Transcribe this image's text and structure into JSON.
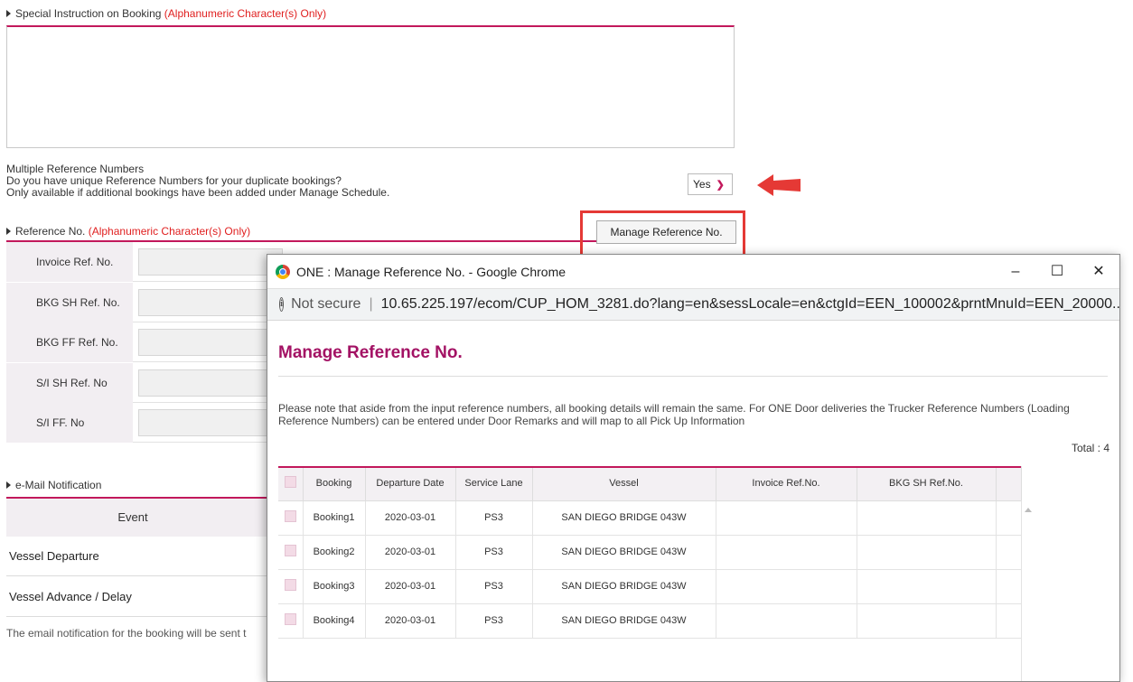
{
  "special_instruction": {
    "label": "Special Instruction on Booking",
    "note": "(Alphanumeric Character(s) Only)",
    "value": ""
  },
  "multiple_ref": {
    "title": "Multiple Reference Numbers",
    "question": "Do you have unique Reference Numbers for your duplicate bookings?",
    "hint": "Only available if additional bookings have been added under Manage Schedule.",
    "selected": "Yes"
  },
  "reference": {
    "label": "Reference No.",
    "note": "(Alphanumeric Character(s) Only)",
    "manage_button": "Manage Reference No.",
    "fields": [
      {
        "label": "Invoice Ref. No.",
        "value": ""
      },
      {
        "label": "BKG SH Ref. No.",
        "value": ""
      },
      {
        "label": "BKG FF Ref. No.",
        "value": ""
      },
      {
        "label": "S/I SH Ref. No",
        "value": ""
      },
      {
        "label": "S/I FF. No",
        "value": ""
      }
    ]
  },
  "email": {
    "label": "e-Mail Notification",
    "event_header": "Event",
    "events": [
      "Vessel Departure",
      "Vessel Advance / Delay"
    ],
    "footnote": "The email notification for the booking will be sent t"
  },
  "popup": {
    "window_title": "ONE : Manage Reference No. - Google Chrome",
    "controls": {
      "minimize": "–",
      "maximize": "☐",
      "close": "✕"
    },
    "not_secure": "Not secure",
    "url": "10.65.225.197/ecom/CUP_HOM_3281.do?lang=en&sessLocale=en&ctgId=EEN_100002&prntMnuId=EEN_20000...",
    "title": "Manage Reference No.",
    "note": "Please note that aside from the input reference numbers, all booking details will remain the same. For ONE Door deliveries the Trucker Reference Numbers (Loading Reference Numbers) can be entered under Door Remarks and will map to all Pick Up Information",
    "total": "Total : 4",
    "columns": [
      "Booking",
      "Departure Date",
      "Service Lane",
      "Vessel",
      "Invoice Ref.No.",
      "BKG SH Ref.No."
    ],
    "rows": [
      {
        "booking": "Booking1",
        "date": "2020-03-01",
        "lane": "PS3",
        "vessel": "SAN DIEGO BRIDGE 043W",
        "inv": "",
        "bkg": ""
      },
      {
        "booking": "Booking2",
        "date": "2020-03-01",
        "lane": "PS3",
        "vessel": "SAN DIEGO BRIDGE 043W",
        "inv": "",
        "bkg": ""
      },
      {
        "booking": "Booking3",
        "date": "2020-03-01",
        "lane": "PS3",
        "vessel": "SAN DIEGO BRIDGE 043W",
        "inv": "",
        "bkg": ""
      },
      {
        "booking": "Booking4",
        "date": "2020-03-01",
        "lane": "PS3",
        "vessel": "SAN DIEGO BRIDGE 043W",
        "inv": "",
        "bkg": ""
      }
    ]
  },
  "colors": {
    "accent": "#c2185b",
    "warning": "#e02020",
    "title": "#a31264",
    "highlight": "#e53935"
  }
}
